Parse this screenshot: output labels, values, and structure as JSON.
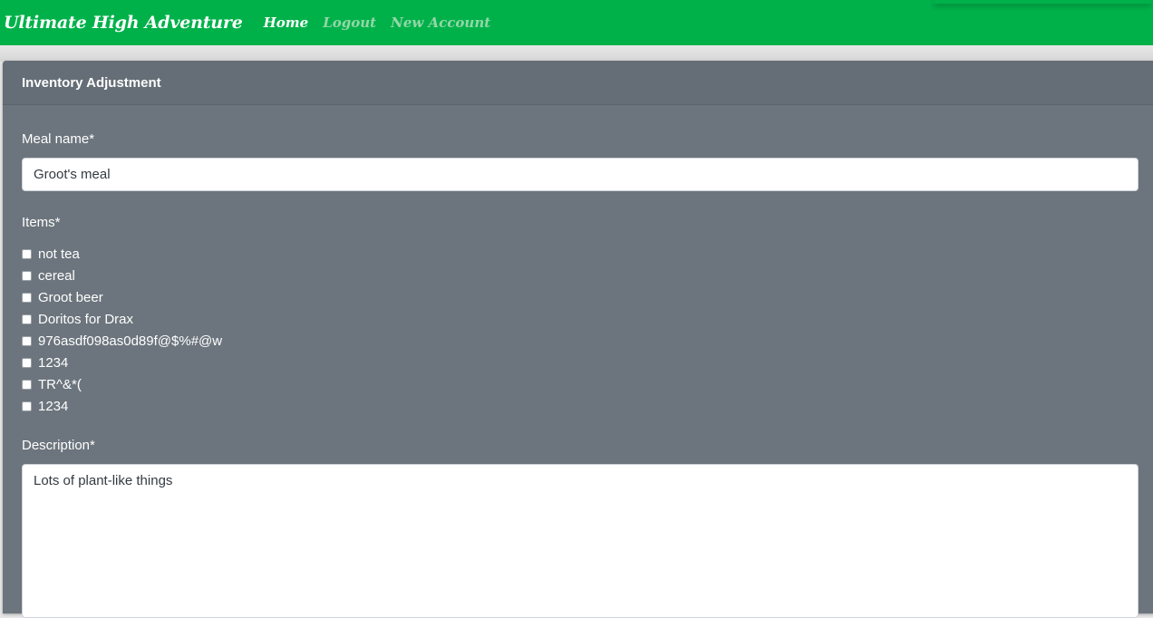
{
  "navbar": {
    "brand": "Ultimate High Adventure",
    "links": [
      {
        "label": "Home",
        "active": true
      },
      {
        "label": "Logout",
        "active": false
      },
      {
        "label": "New Account",
        "active": false
      }
    ],
    "color": "#00b14a"
  },
  "panel": {
    "title": "Inventory Adjustment",
    "color": "#6c757d"
  },
  "form": {
    "meal_name": {
      "label": "Meal name*",
      "value": "Groot's meal"
    },
    "items": {
      "label": "Items*",
      "options": [
        {
          "label": "not tea",
          "checked": false
        },
        {
          "label": "cereal",
          "checked": false
        },
        {
          "label": "Groot beer",
          "checked": false
        },
        {
          "label": "Doritos for Drax",
          "checked": false
        },
        {
          "label": "976asdf098as0d89f@$%#@w",
          "checked": false
        },
        {
          "label": "1234",
          "checked": false
        },
        {
          "label": "TR^&*(",
          "checked": false
        },
        {
          "label": "1234",
          "checked": false
        }
      ]
    },
    "description": {
      "label": "Description*",
      "value": "Lots of plant-like things"
    }
  }
}
